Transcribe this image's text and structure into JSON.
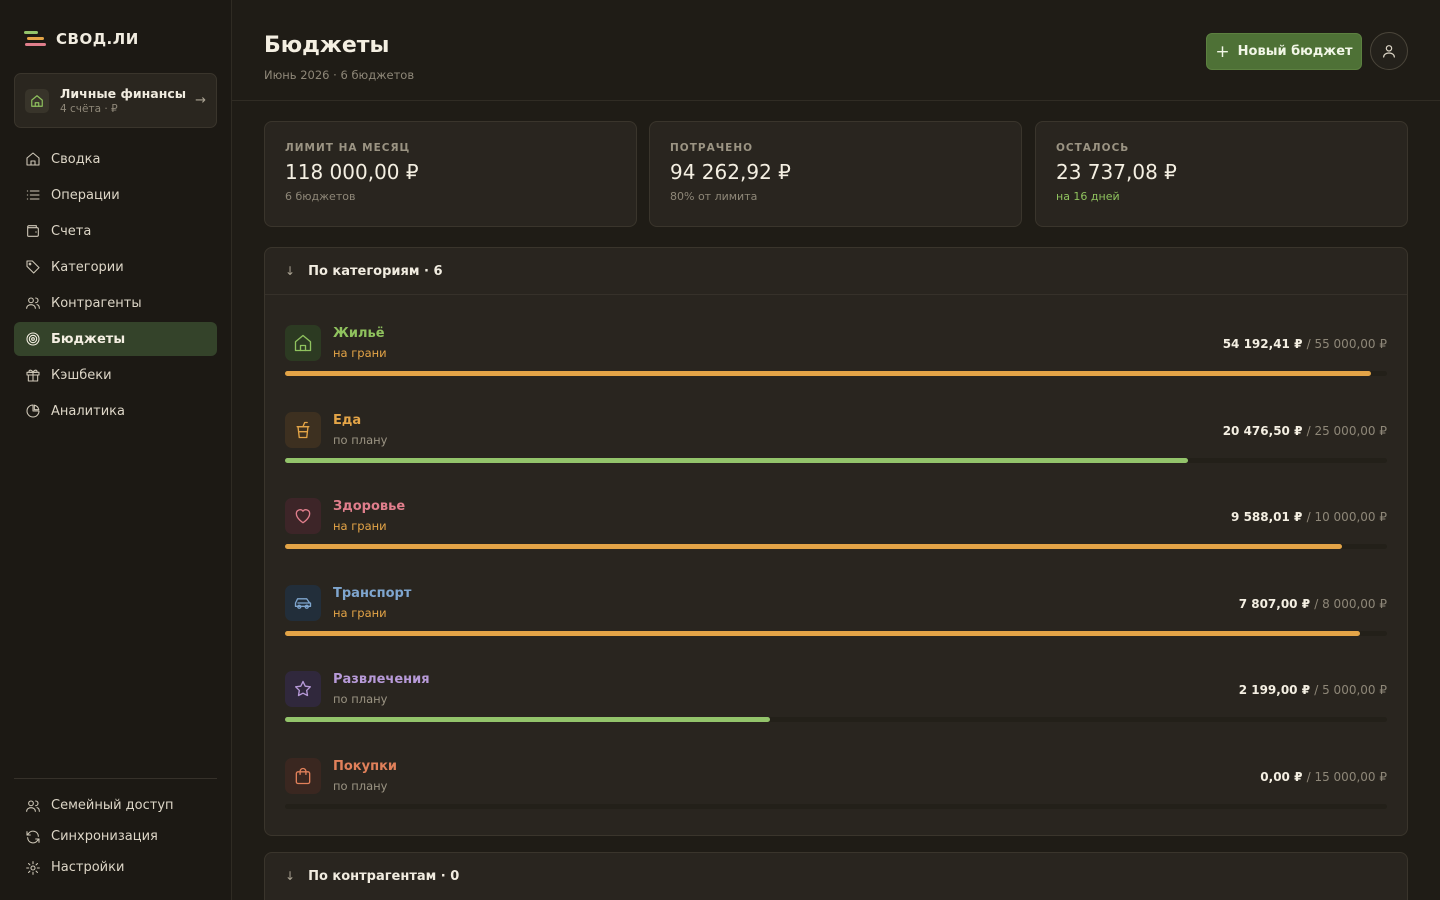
{
  "app": {
    "name": "СВОД.ЛИ"
  },
  "workspace": {
    "title": "Личные финансы",
    "subtitle": "4 счёта · ₽"
  },
  "nav": [
    {
      "label": "Сводка",
      "icon": "home-icon"
    },
    {
      "label": "Операции",
      "icon": "list-icon"
    },
    {
      "label": "Счета",
      "icon": "wallet-icon"
    },
    {
      "label": "Категории",
      "icon": "tag-icon"
    },
    {
      "label": "Контрагенты",
      "icon": "users-icon"
    },
    {
      "label": "Бюджеты",
      "icon": "target-icon",
      "active": true
    },
    {
      "label": "Кэшбеки",
      "icon": "gift-icon"
    },
    {
      "label": "Аналитика",
      "icon": "pie-chart-icon"
    }
  ],
  "bottom_nav": [
    {
      "label": "Семейный доступ",
      "icon": "users-icon"
    },
    {
      "label": "Синхронизация",
      "icon": "refresh-icon"
    },
    {
      "label": "Настройки",
      "icon": "gear-icon"
    }
  ],
  "header": {
    "title": "Бюджеты",
    "subtitle": "Июнь 2026 · 6 бюджетов",
    "new_button": "Новый бюджет"
  },
  "stats": [
    {
      "label": "ЛИМИТ НА МЕСЯЦ",
      "value": "118 000,00 ₽",
      "note": "6 бюджетов"
    },
    {
      "label": "ПОТРАЧЕНО",
      "value": "94 262,92 ₽",
      "note": "80% от лимита"
    },
    {
      "label": "ОСТАЛОСЬ",
      "value": "23 737,08 ₽",
      "note": "на 16 дней"
    }
  ],
  "categories_panel": {
    "title": "По категориям · 6",
    "budgets": [
      {
        "name": "Жильё",
        "status": "на грани",
        "spent": "54 192,41 ₽",
        "limit": "/ 55 000,00 ₽",
        "progress": 0.9853,
        "icon": "home-icon",
        "color": "#8fc25e",
        "icon_bg": "#2c3a22",
        "status_color": "#e3a447",
        "bar_color": "#e3a447"
      },
      {
        "name": "Еда",
        "status": "по плану",
        "spent": "20 476,50 ₽",
        "limit": "/ 25 000,00 ₽",
        "progress": 0.8191,
        "icon": "cup-icon",
        "color": "#e3a447",
        "icon_bg": "#3d3020",
        "status_color": "#9b9483",
        "bar_color": "#93c46b"
      },
      {
        "name": "Здоровье",
        "status": "на грани",
        "spent": "9 588,01 ₽",
        "limit": "/ 10 000,00 ₽",
        "progress": 0.9588,
        "icon": "heart-icon",
        "color": "#e07e8c",
        "icon_bg": "#3d2528",
        "status_color": "#e3a447",
        "bar_color": "#e3a447"
      },
      {
        "name": "Транспорт",
        "status": "на грани",
        "spent": "7 807,00 ₽",
        "limit": "/ 8 000,00 ₽",
        "progress": 0.9759,
        "icon": "car-icon",
        "color": "#7fa6cf",
        "icon_bg": "#222e3a",
        "status_color": "#e3a447",
        "bar_color": "#e3a447"
      },
      {
        "name": "Развлечения",
        "status": "по плану",
        "spent": "2 199,00 ₽",
        "limit": "/ 5 000,00 ₽",
        "progress": 0.4398,
        "icon": "star-icon",
        "color": "#b79ad8",
        "icon_bg": "#30283c",
        "status_color": "#9b9483",
        "bar_color": "#93c46b"
      },
      {
        "name": "Покупки",
        "status": "по плану",
        "spent": "0,00 ₽",
        "limit": "/ 15 000,00 ₽",
        "progress": 0,
        "icon": "bag-icon",
        "color": "#e0805a",
        "icon_bg": "#3a2720",
        "status_color": "#9b9483",
        "bar_color": "#93c46b"
      }
    ]
  },
  "counterparties_panel": {
    "title": "По контрагентам · 0"
  },
  "colors": {
    "accent": "#4e7136",
    "warning": "#e3a447",
    "ok": "#93c46b"
  }
}
